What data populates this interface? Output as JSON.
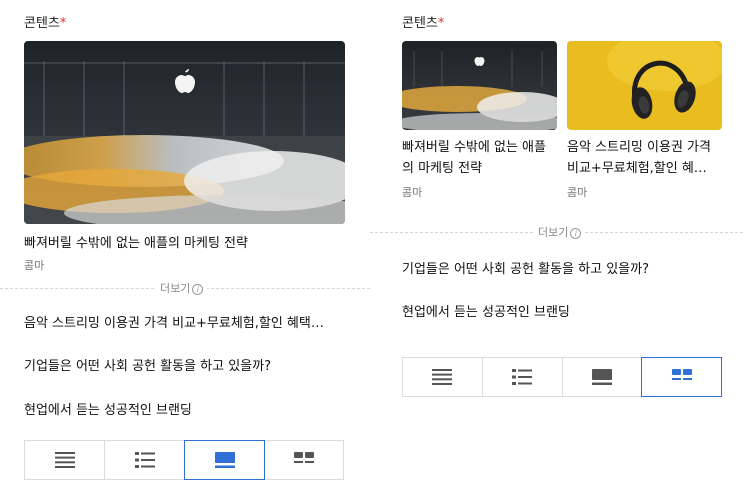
{
  "left": {
    "section_title": "콘텐츠",
    "required_mark": "*",
    "featured": {
      "title": "빠져버릴 수밖에 없는 애플의 마케팅 전략",
      "source": "콤마"
    },
    "more_label": "더보기",
    "info_glyph": "i",
    "list_items": [
      "음악 스트리밍 이용권 가격 비교+무료체험,할인 혜택…",
      "기업들은 어떤 사회 공헌 활동을 하고 있을까?",
      "현업에서 듣는 성공적인 브랜딩"
    ],
    "layout_options": [
      "list-compact",
      "list-bullets",
      "card-large",
      "card-grid"
    ],
    "active_layout": "card-large"
  },
  "right": {
    "section_title": "콘텐츠",
    "required_mark": "*",
    "cards": [
      {
        "title_line1": "빠져버릴 수밖에 없는 애플",
        "title_line2": "의 마케팅 전략",
        "source": "콤마"
      },
      {
        "title_line1": "음악 스트리밍 이용권 가격",
        "title_line2": "비교+무료체험,할인 혜…",
        "source": "콤마"
      }
    ],
    "more_label": "더보기",
    "info_glyph": "i",
    "list_items": [
      "기업들은 어떤 사회 공헌 활동을 하고 있을까?",
      "현업에서 듣는 성공적인 브랜딩"
    ],
    "layout_options": [
      "list-compact",
      "list-bullets",
      "card-large",
      "card-grid"
    ],
    "active_layout": "card-grid"
  },
  "colors": {
    "accent": "#2f6fd6",
    "required": "#e3342f",
    "icon_gray": "#555555"
  }
}
